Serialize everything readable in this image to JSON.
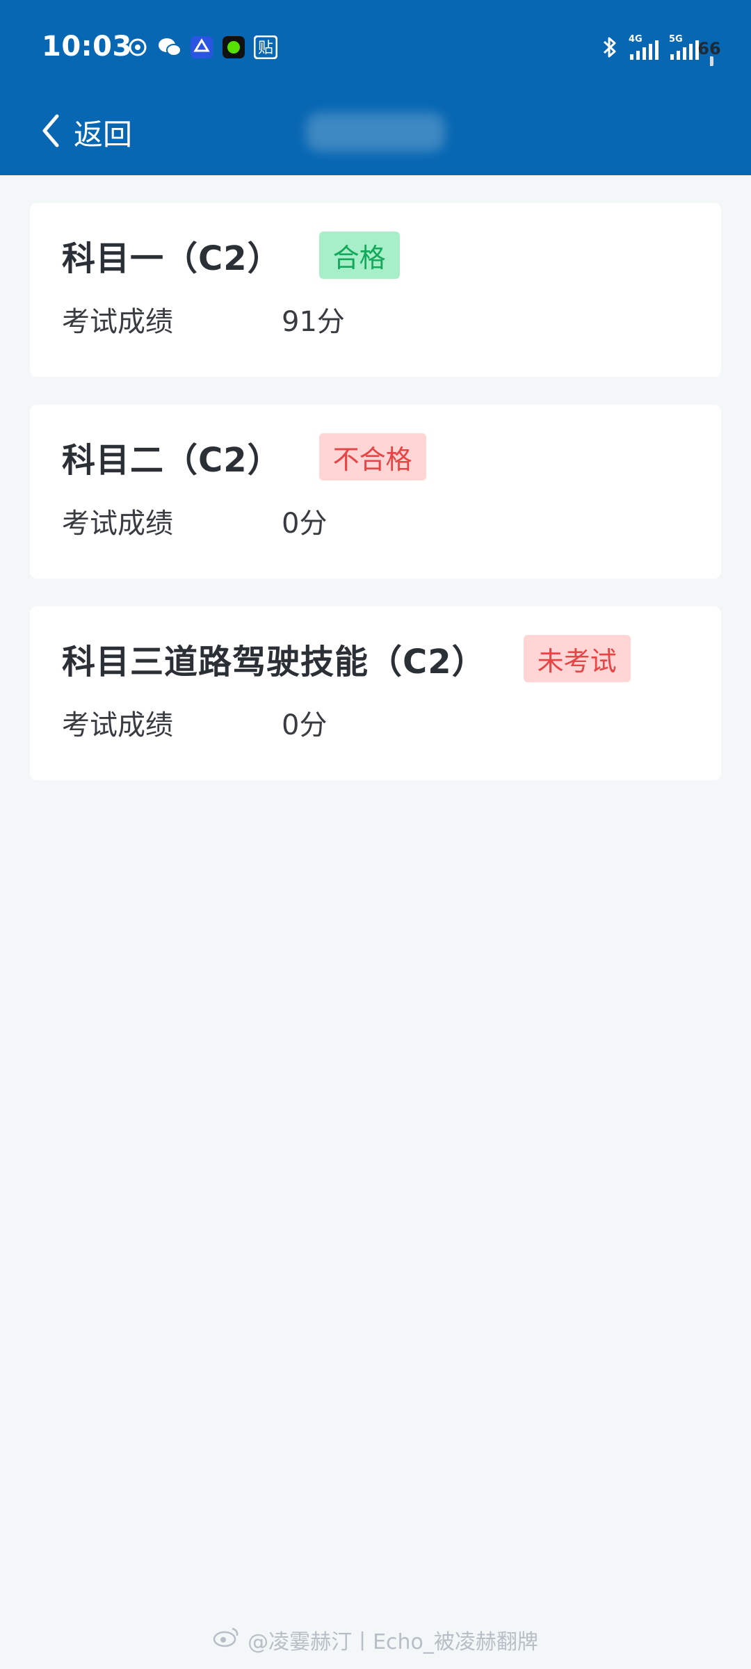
{
  "status_bar": {
    "time": "10:03",
    "notification_icons": [
      "sync-icon",
      "wechat-icon",
      "app-icon",
      "green-dot-icon",
      "tie-icon"
    ],
    "tie_label": "贴",
    "network": [
      "4G",
      "5G"
    ],
    "battery": "66",
    "battery_level": 0.66
  },
  "nav": {
    "back_label": "返回"
  },
  "results": [
    {
      "subject": "科目一（C2）",
      "status": "合格",
      "status_type": "pass",
      "score_label": "考试成绩",
      "score": "91分"
    },
    {
      "subject": "科目二（C2）",
      "status": "不合格",
      "status_type": "fail",
      "score_label": "考试成绩",
      "score": "0分"
    },
    {
      "subject": "科目三道路驾驶技能（C2）",
      "status": "未考试",
      "status_type": "fail",
      "score_label": "考试成绩",
      "score": "0分"
    }
  ],
  "watermark": "@凌霎赫汀丨Echo_被凌赫翻牌",
  "colors": {
    "header": "#0867b2",
    "background": "#f3f7f8",
    "pass_bg": "#a7efc8",
    "pass_text": "#14a85b",
    "fail_bg": "#ffd5d6",
    "fail_text": "#e64545"
  }
}
